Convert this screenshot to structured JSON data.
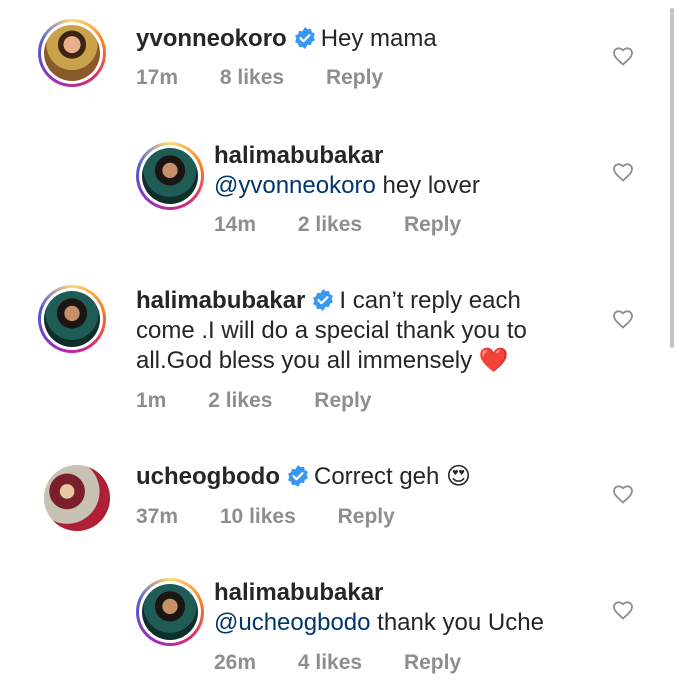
{
  "comments": [
    {
      "username": "yvonneokoro",
      "mention": "",
      "text": "Hey mama",
      "time": "17m",
      "likes": "8 likes",
      "reply": "Reply",
      "verified": true
    },
    {
      "username": "halimabubakar",
      "mention": "@yvonneokoro",
      "text": " hey lover",
      "time": "14m",
      "likes": "2 likes",
      "reply": "Reply",
      "verified": false
    },
    {
      "username": "halimabubakar",
      "mention": "",
      "text_line1": "I can’t reply each",
      "text_line2": "come .I will do a special thank you to",
      "text_line3": "all.God bless you all immensely",
      "emoji": "❤️",
      "time": "1m",
      "likes": "2 likes",
      "reply": "Reply",
      "verified": true
    },
    {
      "username": "ucheogbodo",
      "mention": "",
      "text": "Correct geh",
      "emoji": "😍",
      "time": "37m",
      "likes": "10 likes",
      "reply": "Reply",
      "verified": true
    },
    {
      "username": "halimabubakar",
      "mention": "@ucheogbodo",
      "text": " thank you Uche",
      "time": "26m",
      "likes": "4 likes",
      "reply": "Reply",
      "verified": false
    }
  ],
  "icons": {
    "verified": "verified-badge-icon",
    "like": "heart-outline-icon"
  },
  "colors": {
    "verified_blue": "#3897f0",
    "mention": "#00376b",
    "meta_gray": "#8e8e8e"
  }
}
